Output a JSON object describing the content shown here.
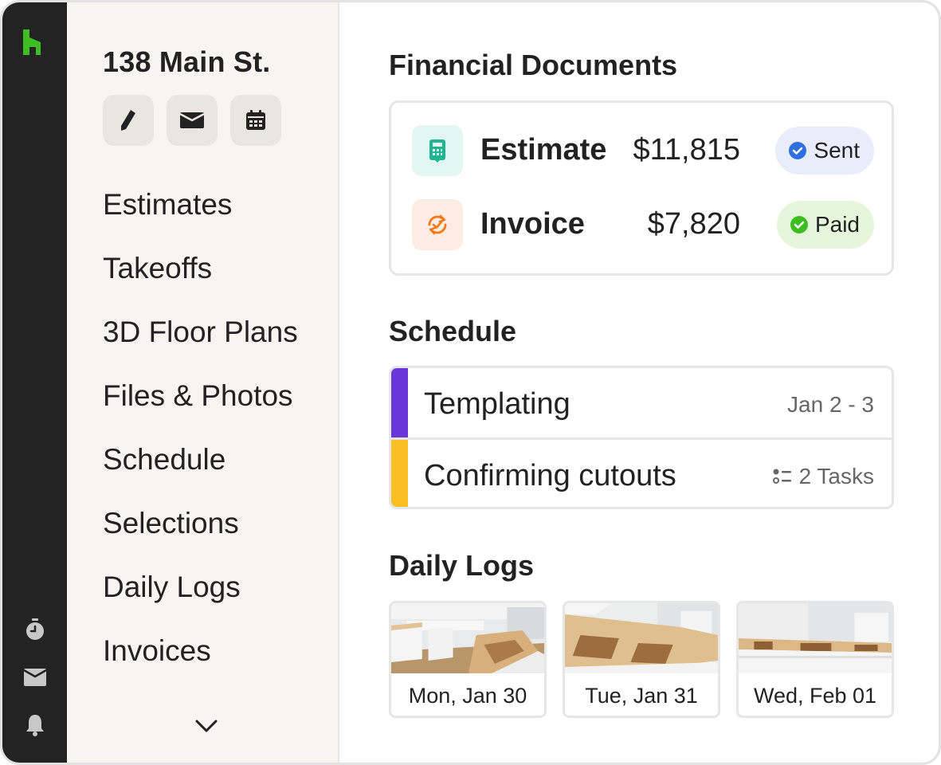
{
  "app": {
    "brand_color": "#3dbd1f"
  },
  "rail": {
    "icons": [
      "logo-icon",
      "timer-icon",
      "inbox-icon",
      "bell-icon"
    ]
  },
  "project": {
    "title": "138 Main St.",
    "actions": [
      "edit-icon",
      "message-icon",
      "calendar-icon"
    ]
  },
  "nav": {
    "items": [
      {
        "label": "Estimates"
      },
      {
        "label": "Takeoffs"
      },
      {
        "label": "3D Floor Plans"
      },
      {
        "label": "Files & Photos"
      },
      {
        "label": "Schedule"
      },
      {
        "label": "Selections"
      },
      {
        "label": "Daily Logs"
      },
      {
        "label": "Invoices"
      }
    ]
  },
  "financial": {
    "title": "Financial Documents",
    "docs": [
      {
        "name": "Estimate",
        "amount": "$11,815",
        "status": "Sent",
        "status_color": "#2f6fe0",
        "badge_bg": "#e9edfb",
        "icon": "calculator-icon",
        "icon_bg": "#e3f6f1",
        "icon_color": "#1fb592"
      },
      {
        "name": "Invoice",
        "amount": "$7,820",
        "status": "Paid",
        "status_color": "#3dbd1f",
        "badge_bg": "#e6f6dc",
        "icon": "sync-check-icon",
        "icon_bg": "#fdece3",
        "icon_color": "#f07a1a"
      }
    ]
  },
  "schedule": {
    "title": "Schedule",
    "items": [
      {
        "label": "Templating",
        "meta": "Jan 2 - 3",
        "color": "#6a35d9"
      },
      {
        "label": "Confirming cutouts",
        "meta": "2 Tasks",
        "color": "#fbbf24"
      }
    ]
  },
  "daily_logs": {
    "title": "Daily Logs",
    "entries": [
      {
        "date": "Mon, Jan 30"
      },
      {
        "date": "Tue, Jan 31"
      },
      {
        "date": "Wed, Feb 01"
      }
    ]
  }
}
